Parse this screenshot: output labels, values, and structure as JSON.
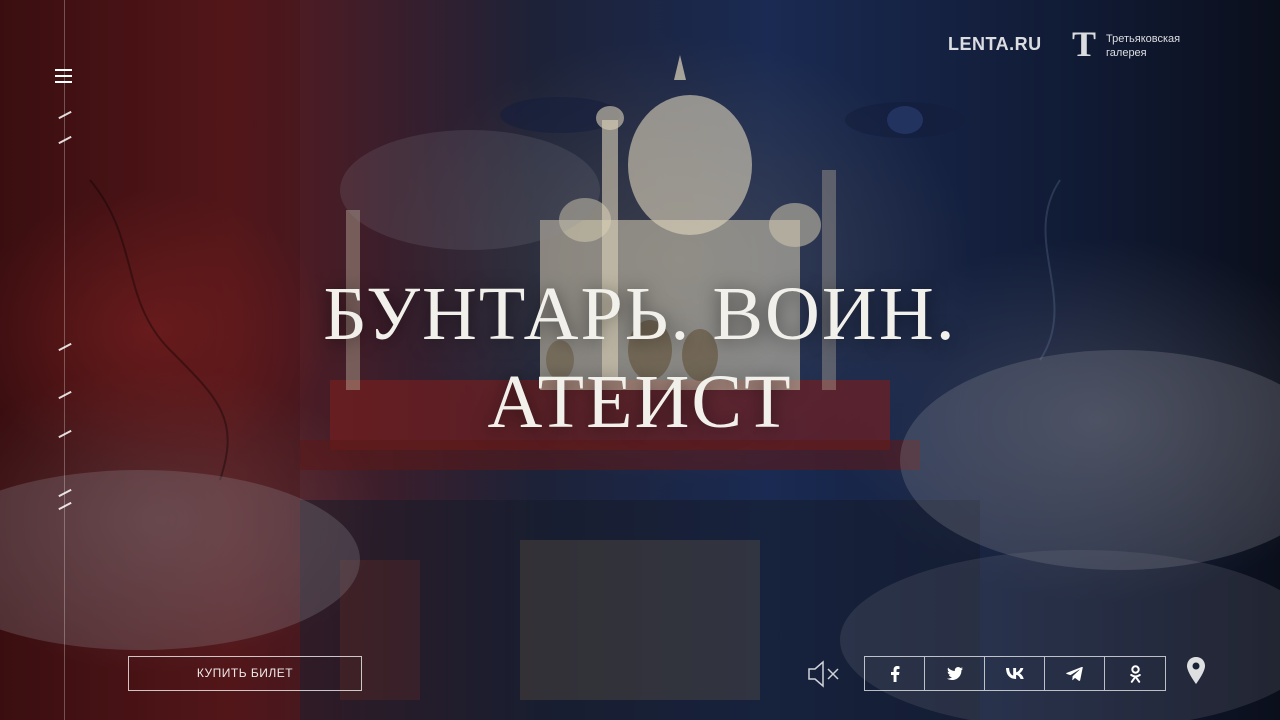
{
  "header": {
    "lenta_logo": "LENTA.RU",
    "gallery_logo_mark": "Т",
    "gallery_logo_line1": "Третьяковская",
    "gallery_logo_line2": "галерея"
  },
  "headline": {
    "line1": "БУНТАРЬ. ВОИН.",
    "line2": "АТЕИСТ"
  },
  "footer": {
    "buy_ticket_label": "КУПИТЬ БИЛЕТ"
  },
  "icons": [
    "menu-icon",
    "sound-off-icon",
    "facebook-icon",
    "twitter-icon",
    "vk-icon",
    "telegram-icon",
    "odnoklassniki-icon",
    "location-pin-icon"
  ],
  "colors": {
    "text": "#ffffff",
    "headline": "#f2f0ea",
    "background": "#0c0f1a"
  }
}
